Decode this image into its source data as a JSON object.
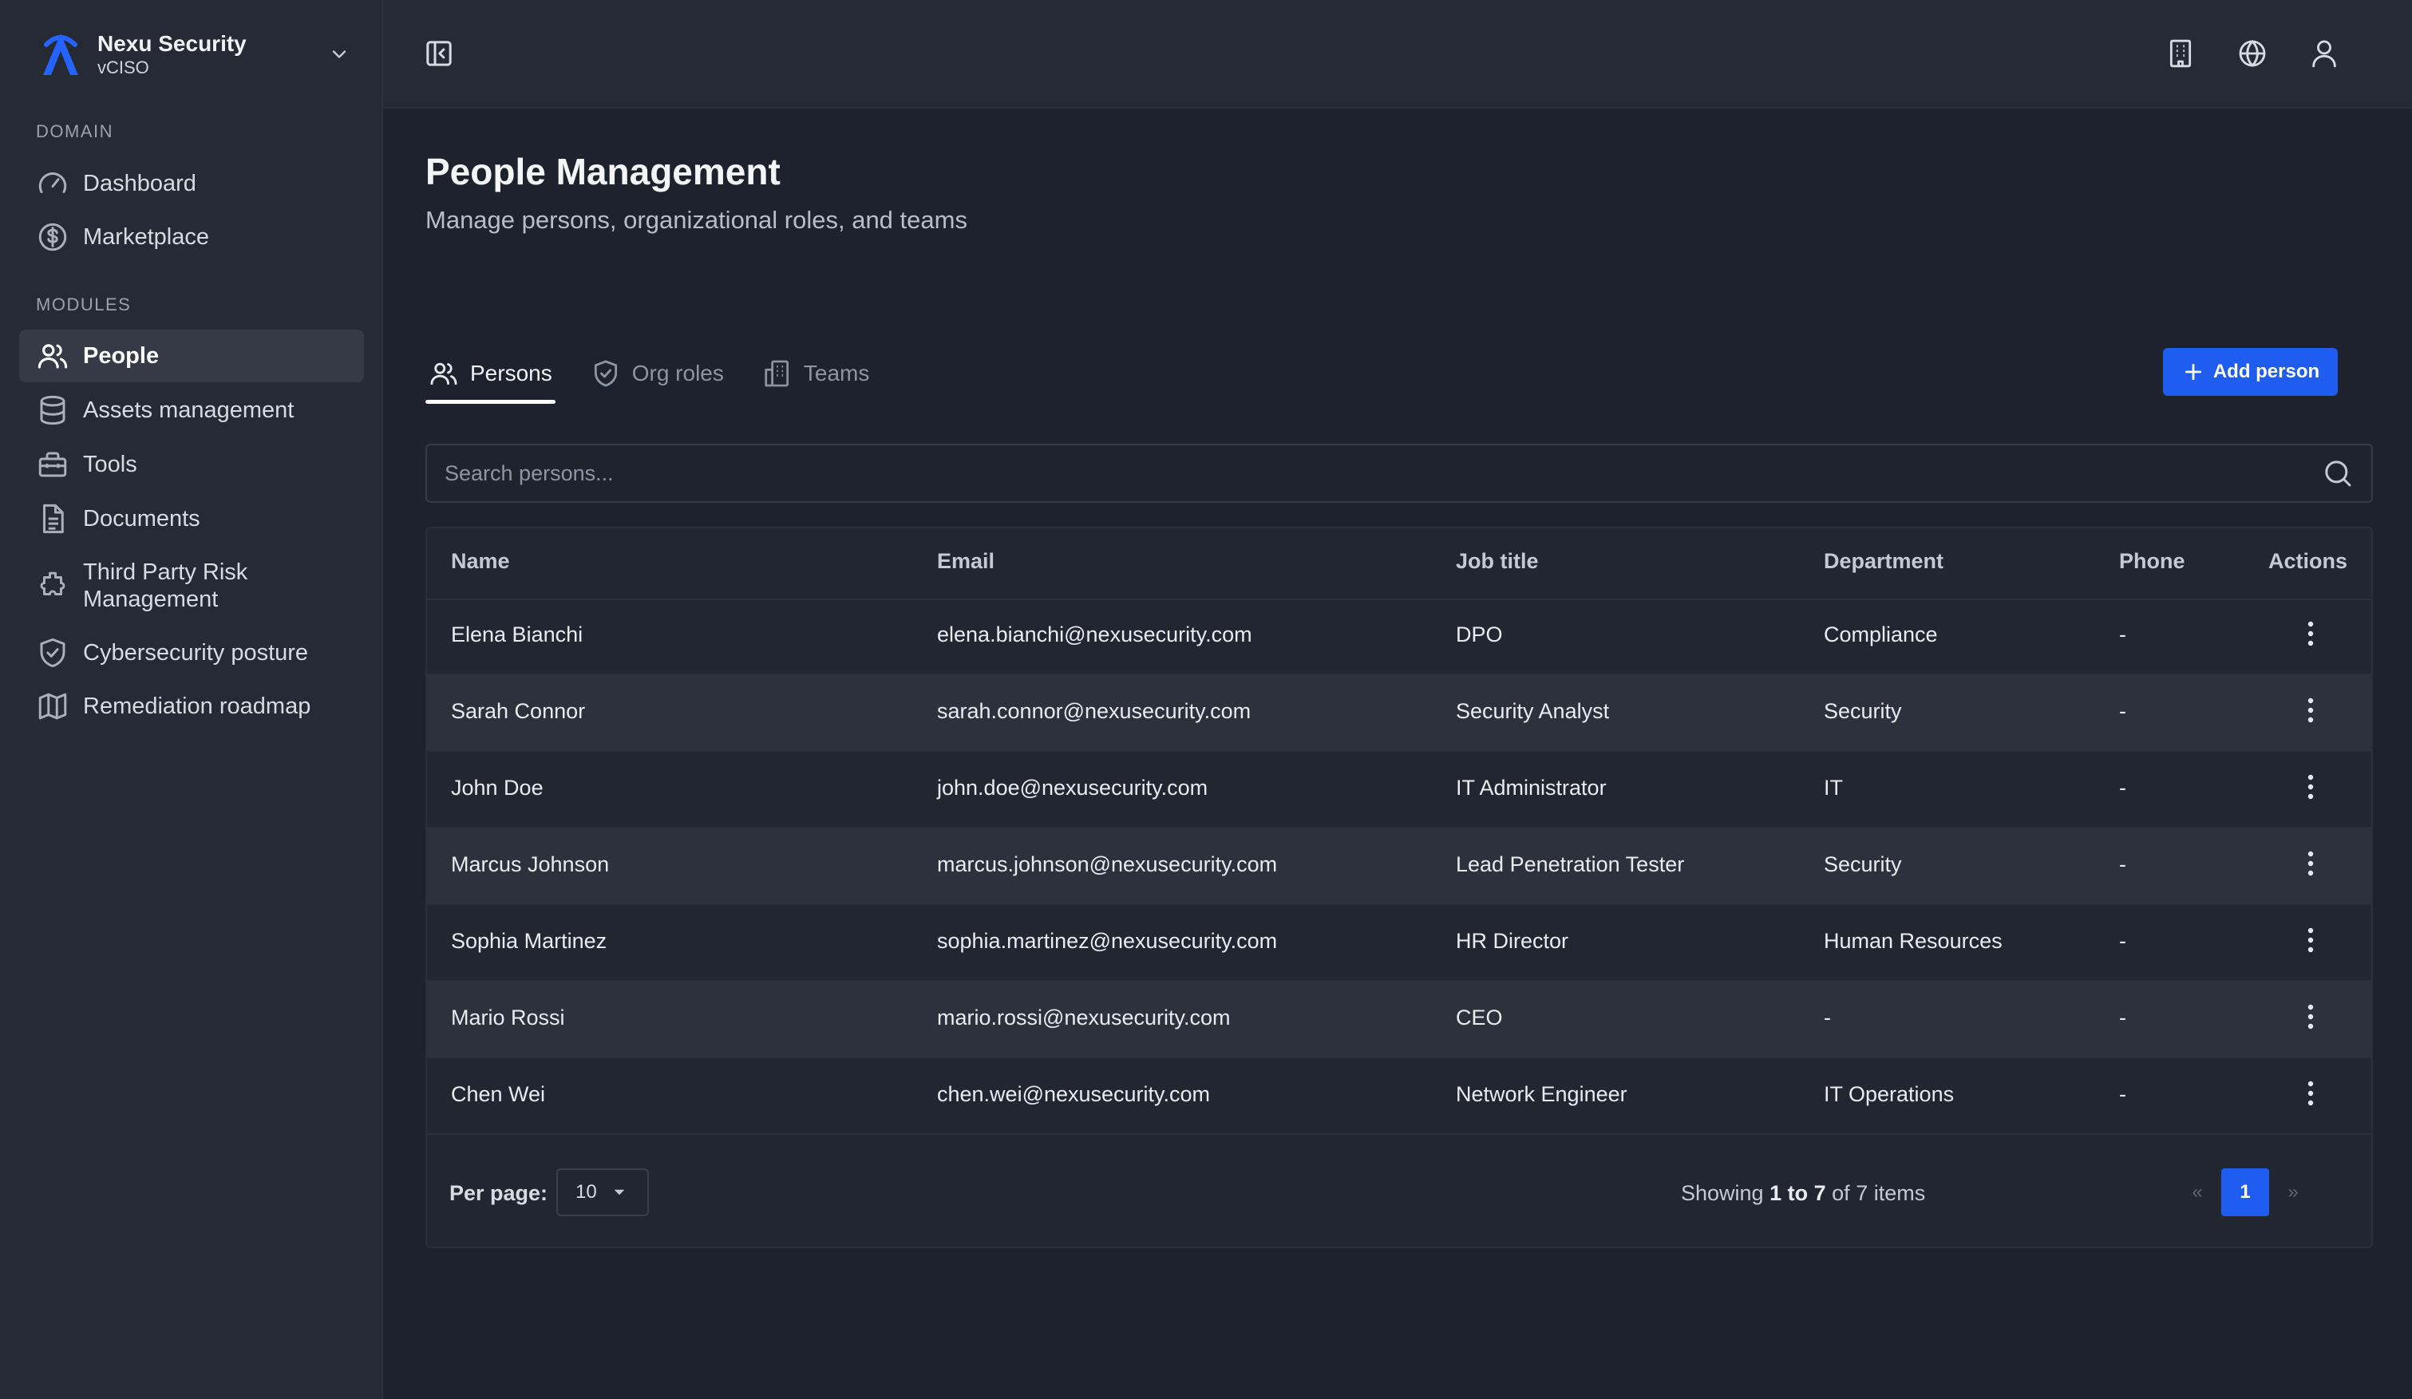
{
  "brand": {
    "name": "Nexu Security",
    "subtitle": "vCISO",
    "logo_icon": "nexu-logo-icon",
    "accent": "#1f5df0"
  },
  "sidebar": {
    "sections": [
      {
        "label": "DOMAIN",
        "items": [
          {
            "label": "Dashboard",
            "icon": "gauge-icon"
          },
          {
            "label": "Marketplace",
            "icon": "dollar-circle-icon"
          }
        ]
      },
      {
        "label": "MODULES",
        "items": [
          {
            "label": "People",
            "icon": "users-icon",
            "active": true
          },
          {
            "label": "Assets management",
            "icon": "database-icon"
          },
          {
            "label": "Tools",
            "icon": "toolbox-icon"
          },
          {
            "label": "Documents",
            "icon": "document-icon"
          },
          {
            "label": "Third Party Risk Management",
            "icon": "puzzle-icon"
          },
          {
            "label": "Cybersecurity posture",
            "icon": "shield-check-icon"
          },
          {
            "label": "Remediation roadmap",
            "icon": "map-icon"
          }
        ]
      }
    ]
  },
  "topbar": {
    "icons": [
      "sidebar-toggle-icon",
      "building-icon",
      "globe-icon",
      "user-icon"
    ]
  },
  "page": {
    "title": "People Management",
    "subtitle": "Manage persons, organizational roles, and teams"
  },
  "tabs": [
    {
      "label": "Persons",
      "icon": "users-icon",
      "active": true
    },
    {
      "label": "Org roles",
      "icon": "shield-check-icon"
    },
    {
      "label": "Teams",
      "icon": "building-icon"
    }
  ],
  "add_button": {
    "label": "Add person",
    "icon": "plus-icon"
  },
  "search": {
    "placeholder": "Search persons...",
    "value": ""
  },
  "table": {
    "columns": [
      "Name",
      "Email",
      "Job title",
      "Department",
      "Phone",
      "Actions"
    ],
    "rows": [
      {
        "name": "Elena Bianchi",
        "email": "elena.bianchi@nexusecurity.com",
        "job": "DPO",
        "dept": "Compliance",
        "phone": "-"
      },
      {
        "name": "Sarah Connor",
        "email": "sarah.connor@nexusecurity.com",
        "job": "Security Analyst",
        "dept": "Security",
        "phone": "-"
      },
      {
        "name": "John Doe",
        "email": "john.doe@nexusecurity.com",
        "job": "IT Administrator",
        "dept": "IT",
        "phone": "-"
      },
      {
        "name": "Marcus Johnson",
        "email": "marcus.johnson@nexusecurity.com",
        "job": "Lead Penetration Tester",
        "dept": "Security",
        "phone": "-"
      },
      {
        "name": "Sophia Martinez",
        "email": "sophia.martinez@nexusecurity.com",
        "job": "HR Director",
        "dept": "Human Resources",
        "phone": "-"
      },
      {
        "name": "Mario Rossi",
        "email": "mario.rossi@nexusecurity.com",
        "job": "CEO",
        "dept": "-",
        "phone": "-"
      },
      {
        "name": "Chen Wei",
        "email": "chen.wei@nexusecurity.com",
        "job": "Network Engineer",
        "dept": "IT Operations",
        "phone": "-"
      }
    ]
  },
  "pagination": {
    "per_page_label": "Per page:",
    "per_page_value": "10",
    "showing_prefix": "Showing",
    "showing_range": "1 to 7",
    "showing_of": "of",
    "showing_total": "7",
    "showing_suffix": "items",
    "prev": "«",
    "current_page": "1",
    "next": "»"
  }
}
